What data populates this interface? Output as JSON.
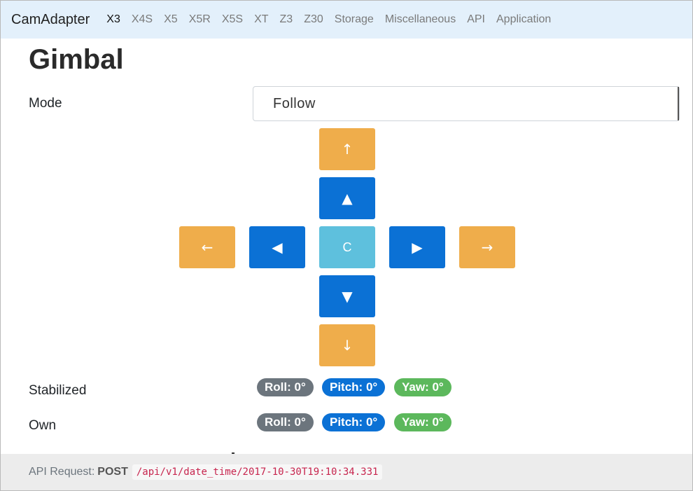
{
  "navbar": {
    "brand": "CamAdapter",
    "items": [
      {
        "label": "X3",
        "active": true
      },
      {
        "label": "X4S",
        "active": false
      },
      {
        "label": "X5",
        "active": false
      },
      {
        "label": "X5R",
        "active": false
      },
      {
        "label": "X5S",
        "active": false
      },
      {
        "label": "XT",
        "active": false
      },
      {
        "label": "Z3",
        "active": false
      },
      {
        "label": "Z30",
        "active": false
      },
      {
        "label": "Storage",
        "active": false
      },
      {
        "label": "Miscellaneous",
        "active": false
      },
      {
        "label": "API",
        "active": false
      },
      {
        "label": "Application",
        "active": false
      }
    ]
  },
  "page": {
    "title": "Gimbal",
    "mode_label": "Mode",
    "mode_value": "Follow"
  },
  "dpad": {
    "top_outer": "↑",
    "up": "▲",
    "left_outer": "←",
    "left": "◀",
    "center": "C",
    "right": "▶",
    "right_outer": "→",
    "down": "▼",
    "bottom_outer": "↓",
    "colors": {
      "orange": "#efad4b",
      "blue": "#0b71d5",
      "teal": "#5ec0dd"
    }
  },
  "stabilized": {
    "label": "Stabilized",
    "roll": "Roll: 0°",
    "pitch": "Pitch: 0°",
    "yaw": "Yaw: 0°"
  },
  "own": {
    "label": "Own",
    "roll": "Roll: 0°",
    "pitch": "Pitch: 0°",
    "yaw": "Yaw: 0°"
  },
  "footer": {
    "prefix": "API Request:",
    "method": "POST",
    "endpoint": "/api/v1/date_time/2017-10-30T19:10:34.331"
  }
}
